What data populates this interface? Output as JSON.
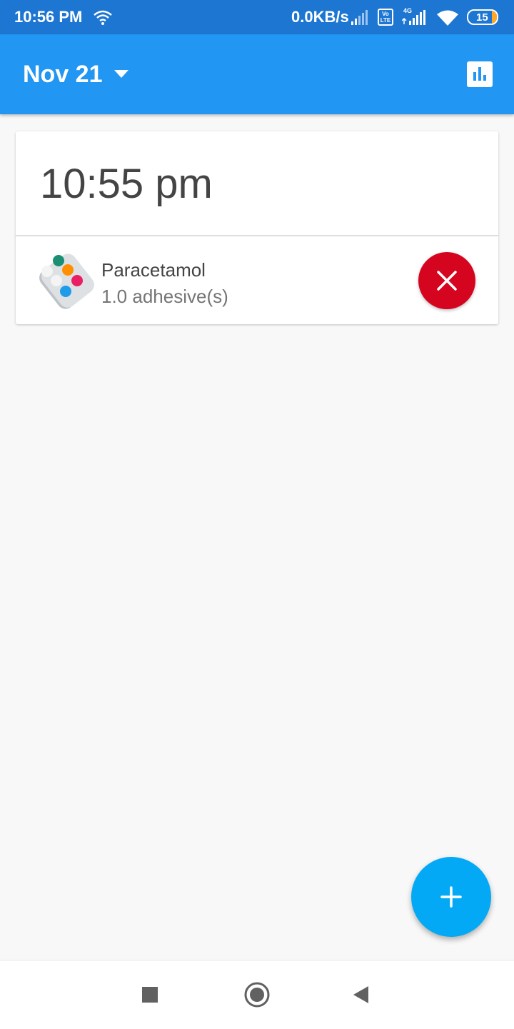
{
  "status_bar": {
    "time": "10:56 PM",
    "network_speed": "0.0KB/s",
    "network_type": "4G",
    "volte_label": "Vo LTE",
    "battery_level": "15"
  },
  "app_bar": {
    "date_label": "Nov 21",
    "dropdown_icon": "arrow-drop-down-icon",
    "stats_icon": "bar-chart-icon"
  },
  "schedule": {
    "time": "10:55 pm",
    "medications": [
      {
        "name": "Paracetamol",
        "dose": "1.0 adhesive(s)",
        "icon": "pill-blister-icon"
      }
    ]
  },
  "fab": {
    "icon": "plus-icon"
  },
  "nav_bar": {
    "items": [
      "recents-square-icon",
      "home-circle-icon",
      "back-triangle-icon"
    ]
  },
  "colors": {
    "status_bar": "#1c76d2",
    "app_bar": "#2196f3",
    "delete": "#d50520",
    "fab": "#03a9f4",
    "background": "#f8f8f8"
  }
}
